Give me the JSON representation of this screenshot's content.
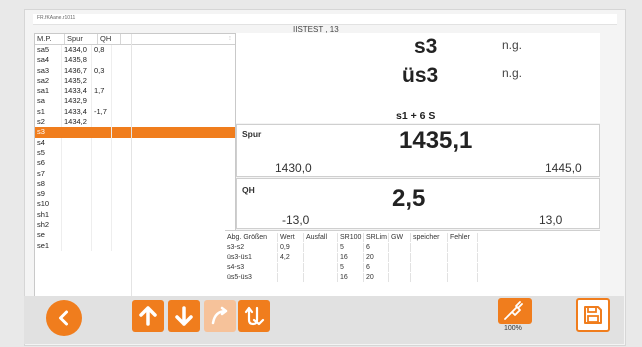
{
  "app": {
    "window_title": "FR.fKAane.r1011",
    "subtitle": "IISTEST , 13"
  },
  "mp_table": {
    "headers": [
      "M.P.",
      "Spur",
      "QH"
    ],
    "rows": [
      {
        "mp": "sa5",
        "spur": "1434,0",
        "qh": "0,8",
        "selected": false
      },
      {
        "mp": "sa4",
        "spur": "1435,8",
        "qh": "",
        "selected": false
      },
      {
        "mp": "sa3",
        "spur": "1436,7",
        "qh": "0,3",
        "selected": false
      },
      {
        "mp": "sa2",
        "spur": "1435,2",
        "qh": "",
        "selected": false
      },
      {
        "mp": "sa1",
        "spur": "1433,4",
        "qh": "1,7",
        "selected": false
      },
      {
        "mp": "sa",
        "spur": "1432,9",
        "qh": "",
        "selected": false
      },
      {
        "mp": "s1",
        "spur": "1433,4",
        "qh": "-1,7",
        "selected": false
      },
      {
        "mp": "s2",
        "spur": "1434,2",
        "qh": "",
        "selected": false
      },
      {
        "mp": "s3",
        "spur": "",
        "qh": "",
        "selected": true
      },
      {
        "mp": "s4",
        "spur": "",
        "qh": "",
        "selected": false
      },
      {
        "mp": "s5",
        "spur": "",
        "qh": "",
        "selected": false
      },
      {
        "mp": "s6",
        "spur": "",
        "qh": "",
        "selected": false
      },
      {
        "mp": "s7",
        "spur": "",
        "qh": "",
        "selected": false
      },
      {
        "mp": "s8",
        "spur": "",
        "qh": "",
        "selected": false
      },
      {
        "mp": "s9",
        "spur": "",
        "qh": "",
        "selected": false
      },
      {
        "mp": "s10",
        "spur": "",
        "qh": "",
        "selected": false
      },
      {
        "mp": "sh1",
        "spur": "",
        "qh": "",
        "selected": false
      },
      {
        "mp": "sh2",
        "spur": "",
        "qh": "",
        "selected": false
      },
      {
        "mp": "se",
        "spur": "",
        "qh": "",
        "selected": false
      },
      {
        "mp": "se1",
        "spur": "",
        "qh": "",
        "selected": false
      }
    ]
  },
  "status": {
    "point": "s3",
    "point_state": "n.g.",
    "ref": "üs3",
    "ref_state": "n.g.",
    "offset": "s1 + 6 S"
  },
  "spur": {
    "label": "Spur",
    "value": "1435,1",
    "min": "1430,0",
    "max": "1445,0"
  },
  "qh": {
    "label": "QH",
    "value": "2,5",
    "min": "-13,0",
    "max": "13,0"
  },
  "abg": {
    "headers": [
      "Abg. Größen",
      "Wert",
      "Ausfall",
      "SR100",
      "SRLim",
      "GW",
      "speicher",
      "Fehler"
    ],
    "rows": [
      [
        "s3-s2",
        "0,9",
        "",
        "5",
        "6",
        "",
        "",
        ""
      ],
      [
        "üs3-üs1",
        "4,2",
        "",
        "16",
        "20",
        "",
        "",
        ""
      ],
      [
        "s4-s3",
        "",
        "",
        "5",
        "6",
        "",
        "",
        ""
      ],
      [
        "üs5-üs3",
        "",
        "",
        "16",
        "20",
        "",
        "",
        ""
      ]
    ]
  },
  "toolbar": {
    "zoom": "100%",
    "accent": "#f07d1d"
  }
}
